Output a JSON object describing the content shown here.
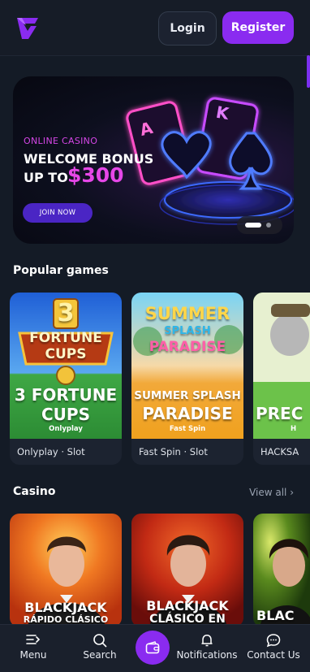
{
  "header": {
    "login_label": "Login",
    "register_label": "Register",
    "logo_icon": "brand-logo-icon"
  },
  "banner": {
    "subtitle": "ONLINE CASINO",
    "title": "WELCOME BONUS",
    "upto": "UP TO",
    "amount": "$300",
    "cta": "JOIN NOW",
    "card_letters": [
      "A",
      "K"
    ],
    "slides_total": 2,
    "slide_active": 1
  },
  "popular": {
    "title": "Popular games",
    "games": [
      {
        "art_title_line1": "3 FORTUNE",
        "art_title_line2": "CUPS",
        "art_provider": "Onlyplay",
        "logo_line1": "FORTUNE",
        "logo_line2": "CUPS",
        "logo_number": "3",
        "meta": "Onlyplay · Slot"
      },
      {
        "art_title_line1": "SUMMER SPLASH",
        "art_title_line2": "PARADISE",
        "art_provider": "Fast Spin",
        "logo_line1": "SUMMER",
        "logo_line2": "SPLASH",
        "logo_line3": "PARADISE",
        "meta": "Fast Spin · Slot"
      },
      {
        "art_title_line1": "PREC",
        "art_provider": "H",
        "meta": "HACKSA"
      }
    ]
  },
  "casino": {
    "title": "Casino",
    "view_all": "View all ›",
    "games": [
      {
        "art_title_line1": "BLACKJACK",
        "art_title_line2": "RÁPIDO CLÁSICO"
      },
      {
        "art_title_line1": "BLACKJACK",
        "art_title_line2": "CLÁSICO EN"
      },
      {
        "art_title_line1": "BLAC"
      }
    ]
  },
  "bottom_nav": {
    "items": [
      {
        "label": "Menu",
        "icon": "menu-icon"
      },
      {
        "label": "Search",
        "icon": "search-icon"
      },
      {
        "label": "",
        "icon": "wallet-icon"
      },
      {
        "label": "Notifications",
        "icon": "bell-icon"
      },
      {
        "label": "Contact Us",
        "icon": "chat-icon"
      }
    ]
  },
  "colors": {
    "accent": "#8a2bf0",
    "background": "#141b26",
    "bonus_pink": "#e647e8"
  }
}
